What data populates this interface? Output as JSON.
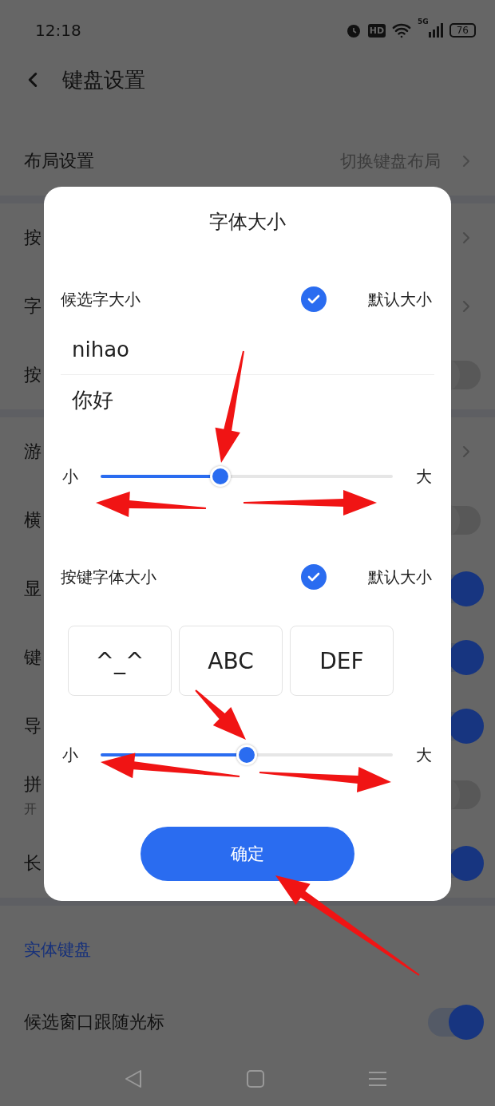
{
  "status_bar": {
    "time": "12:18",
    "hd": "HD",
    "network": "5G",
    "battery": "76"
  },
  "header": {
    "title": "键盘设置"
  },
  "groups": [
    {
      "rows": [
        {
          "kind": "link",
          "label": "布局设置",
          "value": "切换键盘布局"
        }
      ]
    },
    {
      "rows": [
        {
          "kind": "link",
          "label": "按"
        },
        {
          "kind": "link",
          "label": "字"
        },
        {
          "kind": "toggle",
          "label": "按",
          "on": false
        }
      ]
    },
    {
      "rows": [
        {
          "kind": "link",
          "label": "游"
        },
        {
          "kind": "toggle",
          "label": "横",
          "on": false
        },
        {
          "kind": "toggle",
          "label": "显",
          "on": true
        },
        {
          "kind": "toggle",
          "label": "键",
          "on": true
        },
        {
          "kind": "toggle",
          "label": "导",
          "on": true
        },
        {
          "kind": "toggle",
          "label": "拼",
          "subtitle": "开",
          "on": false
        },
        {
          "kind": "toggle",
          "label": "长",
          "on": true
        }
      ]
    },
    {
      "heading": "实体键盘",
      "rows": [
        {
          "kind": "toggle",
          "label": "候选窗口跟随光标",
          "on": true
        }
      ]
    }
  ],
  "dialog": {
    "title": "字体大小",
    "sections": [
      {
        "label": "候选字大小",
        "checked": true,
        "option": "默认大小",
        "preview": [
          "nihao",
          "你好"
        ],
        "slider": {
          "min_label": "小",
          "max_label": "大",
          "level": 0.41
        }
      },
      {
        "label": "按键字体大小",
        "checked": true,
        "option": "默认大小",
        "keys": [
          "^_^",
          "ABC",
          "DEF"
        ],
        "slider": {
          "min_label": "小",
          "max_label": "大",
          "level": 0.5
        }
      }
    ],
    "confirm": "确定"
  }
}
